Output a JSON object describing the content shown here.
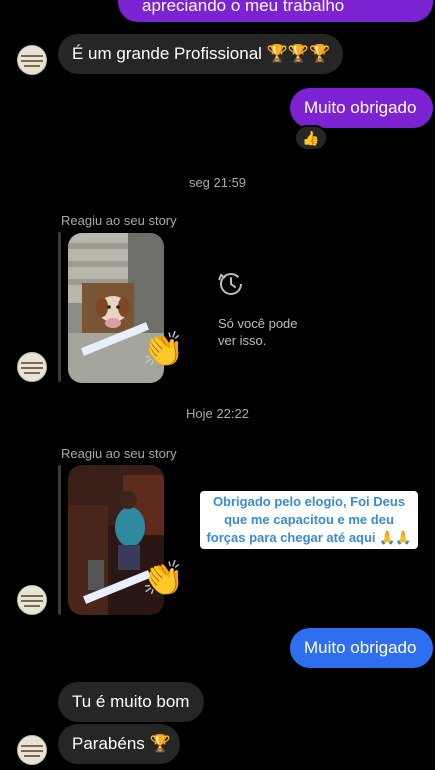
{
  "messages": {
    "m1_partial": "apreciando o meu trabalho",
    "m2": "É um grande Profissional 🏆🏆🏆",
    "m3": "Muito obrigado",
    "m3_reaction": "👍",
    "m4": "Muito obrigado",
    "m5": "Tu é muito bom",
    "m6": "Parabéns 🏆"
  },
  "timestamps": {
    "t1": "seg 21:59",
    "t2": "Hoje 22:22"
  },
  "stories": {
    "reply_label_1": "Reagiu ao seu story",
    "reply_label_2": "Reagiu ao seu story",
    "reaction_1": "👏",
    "reaction_2": "👏",
    "expired_note": "Só você pode\nver isso.",
    "caption_2": "Obrigado pelo elogio, Foi Deus que me capacitou e me deu forças para chegar até aqui 🙏🙏"
  },
  "colors": {
    "purple_bubble": "#7b22d2",
    "blue_bubble": "#2f6ef0",
    "incoming_bubble": "#262626"
  }
}
